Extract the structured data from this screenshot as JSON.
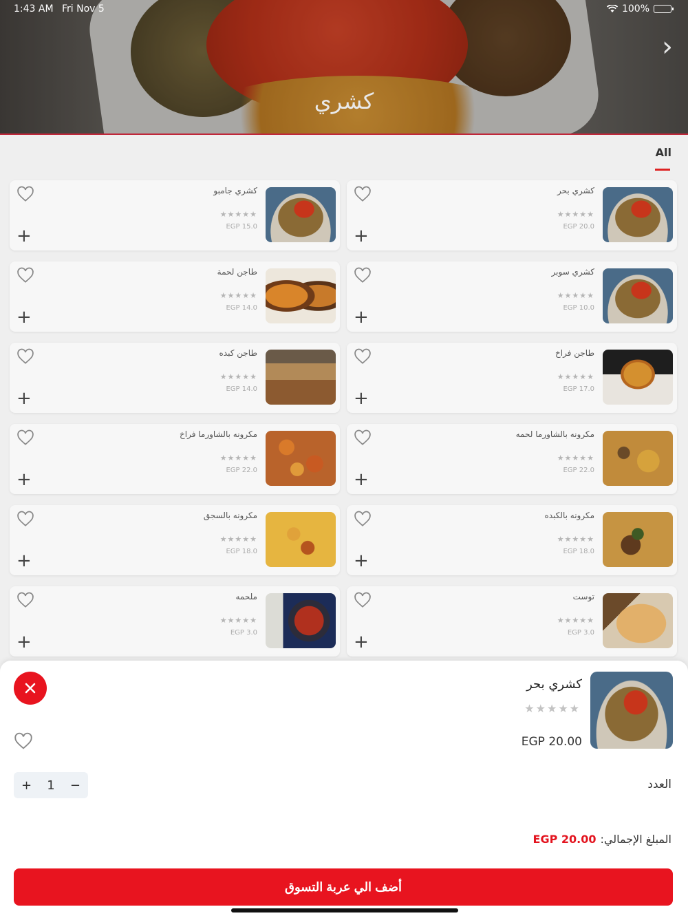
{
  "status_bar": {
    "time": "1:43 AM",
    "date": "Fri Nov 5",
    "battery": "100%"
  },
  "hero": {
    "title": "كشري",
    "next_icon": "chevron-right-icon"
  },
  "tabs": [
    {
      "label": "All",
      "active": true
    }
  ],
  "products": [
    {
      "name": "كشري بحر",
      "price": "EGP 20.0",
      "stars": "★★★★★",
      "image": "koshari"
    },
    {
      "name": "كشري جامبو",
      "price": "EGP 15.0",
      "stars": "★★★★★",
      "image": "koshari"
    },
    {
      "name": "كشري سوبر",
      "price": "EGP 10.0",
      "stars": "★★★★★",
      "image": "koshari"
    },
    {
      "name": "طاجن لحمة",
      "price": "EGP 14.0",
      "stars": "★★★★★",
      "image": "tagen"
    },
    {
      "name": "طاجن فراخ",
      "price": "EGP 17.0",
      "stars": "★★★★★",
      "image": "chicken"
    },
    {
      "name": "طاجن كبده",
      "price": "EGP 14.0",
      "stars": "★★★★★",
      "image": "liver"
    },
    {
      "name": "مكرونه بالشاورما لحمه",
      "price": "EGP 22.0",
      "stars": "★★★★★",
      "image": "pasta2"
    },
    {
      "name": "مكرونه بالشاورما فراخ",
      "price": "EGP 22.0",
      "stars": "★★★★★",
      "image": "pasta"
    },
    {
      "name": "مكرونه بالكبده",
      "price": "EGP 18.0",
      "stars": "★★★★★",
      "image": "liverpasta"
    },
    {
      "name": "مكرونه بالسجق",
      "price": "EGP 18.0",
      "stars": "★★★★★",
      "image": "sausage"
    },
    {
      "name": "توست",
      "price": "EGP 3.0",
      "stars": "★★★★★",
      "image": "toast"
    },
    {
      "name": "ملحمه",
      "price": "EGP 3.0",
      "stars": "★★★★★",
      "image": "soup"
    }
  ],
  "sheet": {
    "name": "كشري بحر",
    "stars": "★★★★★",
    "price": "EGP 20.00",
    "quantity_label": "العدد",
    "quantity": "1",
    "plus": "+",
    "minus": "−",
    "total_label": "المبلغ الإجمالي:",
    "total_value": "EGP 20.00",
    "add_to_cart": "أضف الي عربة التسوق"
  },
  "colors": {
    "accent": "#e8141f"
  }
}
